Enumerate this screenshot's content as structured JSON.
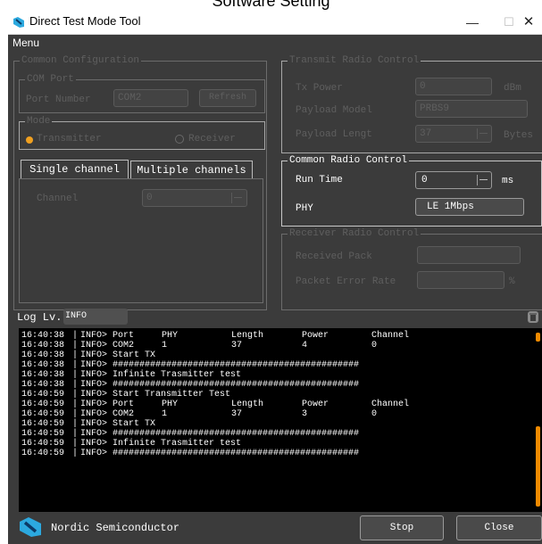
{
  "caption": "Software Setting",
  "window": {
    "title": "Direct Test Mode Tool",
    "minimize": "—",
    "maximize": "☐",
    "close": "✕",
    "menu": "Menu"
  },
  "common_config": {
    "title": "Common Configuration",
    "com_port": {
      "title": "COM Port",
      "port_label": "Port Number",
      "port_value": "COM2",
      "refresh": "Refresh"
    },
    "mode": {
      "title": "Mode",
      "transmitter": "Transmitter",
      "receiver": "Receiver"
    }
  },
  "tabs": {
    "single": "Single channel",
    "multiple": "Multiple channels"
  },
  "single_channel": {
    "channel_label": "Channel",
    "channel_value": "0"
  },
  "transmit_radio": {
    "title": "Transmit Radio Control",
    "tx_power_label": "Tx Power",
    "tx_power_value": "0",
    "tx_power_unit": "dBm",
    "payload_model_label": "Payload Model",
    "payload_model_value": "PRBS9",
    "payload_length_label": "Payload Lengt",
    "payload_length_value": "37",
    "payload_length_unit": "Bytes"
  },
  "common_radio": {
    "title": "Common Radio Control",
    "run_time_label": "Run Time",
    "run_time_value": "0",
    "run_time_unit": "ms",
    "phy_label": "PHY",
    "phy_value": "LE 1Mbps"
  },
  "receiver_radio": {
    "title": "Receiver Radio Control",
    "received_pack_label": "Received Pack",
    "per_label": "Packet Error Rate",
    "per_unit": "%"
  },
  "log": {
    "label": "Log Lv.",
    "level": "INFO",
    "rows": [
      {
        "time": "16:40:38",
        "sep": "|",
        "msg": "INFO> Port",
        "c1": "PHY",
        "c2": "Length",
        "c3": "Power",
        "c4": "Channel"
      },
      {
        "time": "16:40:38",
        "sep": "|",
        "msg": "INFO> COM2",
        "c1": "1",
        "c2": "37",
        "c3": "4",
        "c4": "0"
      },
      {
        "time": "16:40:38",
        "sep": "|",
        "msg": "INFO> Start TX",
        "c1": "",
        "c2": "",
        "c3": "",
        "c4": ""
      },
      {
        "time": "16:40:38",
        "sep": "|",
        "msg": "INFO> ##############################################",
        "c1": "",
        "c2": "",
        "c3": "",
        "c4": ""
      },
      {
        "time": "16:40:38",
        "sep": "|",
        "msg": "INFO> Infinite Trasmitter test",
        "c1": "",
        "c2": "",
        "c3": "",
        "c4": ""
      },
      {
        "time": "16:40:38",
        "sep": "|",
        "msg": "INFO> ##############################################",
        "c1": "",
        "c2": "",
        "c3": "",
        "c4": ""
      },
      {
        "time": "16:40:59",
        "sep": "|",
        "msg": "INFO> Start Transmitter Test",
        "c1": "",
        "c2": "",
        "c3": "",
        "c4": ""
      },
      {
        "time": "16:40:59",
        "sep": "|",
        "msg": "INFO> Port",
        "c1": "PHY",
        "c2": "Length",
        "c3": "Power",
        "c4": "Channel"
      },
      {
        "time": "16:40:59",
        "sep": "|",
        "msg": "INFO> COM2",
        "c1": "1",
        "c2": "37",
        "c3": "3",
        "c4": "0"
      },
      {
        "time": "16:40:59",
        "sep": "|",
        "msg": "INFO> Start TX",
        "c1": "",
        "c2": "",
        "c3": "",
        "c4": ""
      },
      {
        "time": "16:40:59",
        "sep": "|",
        "msg": "INFO> ##############################################",
        "c1": "",
        "c2": "",
        "c3": "",
        "c4": ""
      },
      {
        "time": "16:40:59",
        "sep": "|",
        "msg": "INFO> Infinite Trasmitter test",
        "c1": "",
        "c2": "",
        "c3": "",
        "c4": ""
      },
      {
        "time": "16:40:59",
        "sep": "|",
        "msg": "INFO> ##############################################",
        "c1": "",
        "c2": "",
        "c3": "",
        "c4": ""
      }
    ]
  },
  "footer": {
    "brand": "Nordic Semiconductor",
    "stop": "Stop",
    "close": "Close"
  },
  "colors": {
    "background": "#3b3b3b",
    "log_background": "#000000",
    "accent": "#f08a00",
    "disabled_text": "#5f5f5f"
  },
  "icons": {
    "app": "nordic-logo-icon",
    "trash": "trash-icon",
    "radio": "radio-button-icon"
  }
}
